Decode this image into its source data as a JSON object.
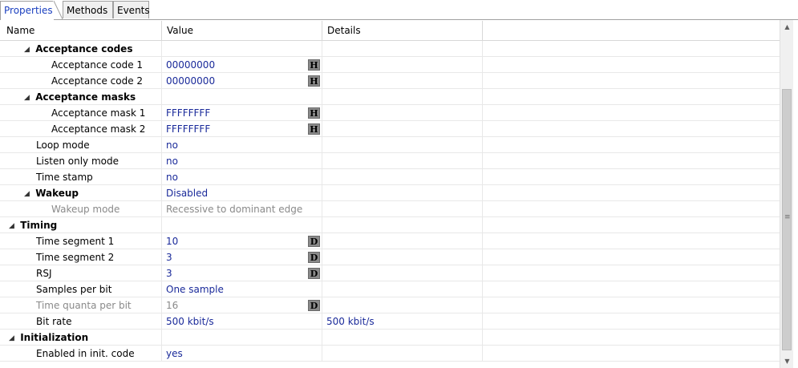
{
  "tabs": [
    {
      "label": "Properties",
      "active": true
    },
    {
      "label": "Methods",
      "active": false
    },
    {
      "label": "Events",
      "active": false
    }
  ],
  "columns": {
    "name": "Name",
    "value": "Value",
    "details": "Details"
  },
  "rows": [
    {
      "name": "Acceptance codes",
      "value": "",
      "details": "",
      "badge": "",
      "level": 1,
      "group": true
    },
    {
      "name": "Acceptance code 1",
      "value": "00000000",
      "details": "",
      "badge": "H",
      "level": 2
    },
    {
      "name": "Acceptance code 2",
      "value": "00000000",
      "details": "",
      "badge": "H",
      "level": 2
    },
    {
      "name": "Acceptance masks",
      "value": "",
      "details": "",
      "badge": "",
      "level": 1,
      "group": true
    },
    {
      "name": "Acceptance mask 1",
      "value": "FFFFFFFF",
      "details": "",
      "badge": "H",
      "level": 2
    },
    {
      "name": "Acceptance mask 2",
      "value": "FFFFFFFF",
      "details": "",
      "badge": "H",
      "level": 2
    },
    {
      "name": "Loop mode",
      "value": "no",
      "details": "",
      "badge": "",
      "level": 1
    },
    {
      "name": "Listen only mode",
      "value": "no",
      "details": "",
      "badge": "",
      "level": 1
    },
    {
      "name": "Time stamp",
      "value": "no",
      "details": "",
      "badge": "",
      "level": 1
    },
    {
      "name": "Wakeup",
      "value": "Disabled",
      "details": "",
      "badge": "",
      "level": 1,
      "group": true
    },
    {
      "name": "Wakeup mode",
      "value": "Recessive to dominant edge",
      "details": "",
      "badge": "",
      "level": 2,
      "disabled": true
    },
    {
      "name": "Timing",
      "value": "",
      "details": "",
      "badge": "",
      "level": 0,
      "group": true
    },
    {
      "name": "Time segment 1",
      "value": "10",
      "details": "",
      "badge": "D",
      "level": 1
    },
    {
      "name": "Time segment 2",
      "value": "3",
      "details": "",
      "badge": "D",
      "level": 1
    },
    {
      "name": "RSJ",
      "value": "3",
      "details": "",
      "badge": "D",
      "level": 1
    },
    {
      "name": "Samples per bit",
      "value": "One sample",
      "details": "",
      "badge": "",
      "level": 1
    },
    {
      "name": "Time quanta per bit",
      "value": "16",
      "details": "",
      "badge": "D",
      "level": 1,
      "disabled": true
    },
    {
      "name": "Bit rate",
      "value": "500 kbit/s",
      "details": "500 kbit/s",
      "badge": "",
      "level": 1
    },
    {
      "name": "Initialization",
      "value": "",
      "details": "",
      "badge": "",
      "level": 0,
      "group": true
    },
    {
      "name": "Enabled in init. code",
      "value": "yes",
      "details": "",
      "badge": "",
      "level": 1
    }
  ],
  "icons": {
    "expanded": "collapse-triangle-icon",
    "scroll_up": "scroll-up-arrow-icon",
    "scroll_down": "scroll-down-arrow-icon",
    "grip": "scroll-grip-icon"
  },
  "colors": {
    "value_text": "#1a2a9a",
    "active_tab_text": "#1a3fbf",
    "disabled_text": "#8a8a8a",
    "badge_bg": "#8a8a8a"
  }
}
